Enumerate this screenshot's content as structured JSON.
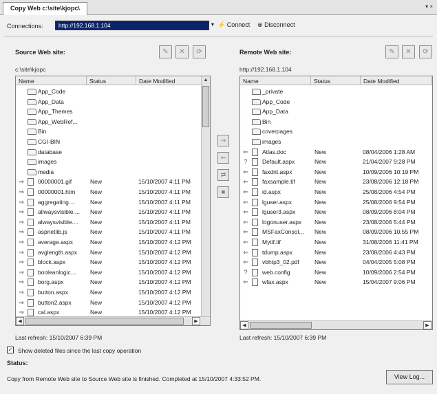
{
  "tab": {
    "title": "Copy Web c:\\site\\kjopc\\",
    "menu_glyph": "▾ ×"
  },
  "connection": {
    "label": "Connections:",
    "url": "http://192.168.1.104",
    "connect_label": "Connect",
    "disconnect_label": "Disconnect"
  },
  "source": {
    "title": "Source Web site:",
    "path": "c:\\site\\kjopc",
    "columns": {
      "name": "Name",
      "status": "Status",
      "date": "Date Modified"
    },
    "rows": [
      {
        "arrow": "",
        "icon": "folder",
        "name": "App_Code",
        "status": "",
        "date": ""
      },
      {
        "arrow": "",
        "icon": "folder",
        "name": "App_Data",
        "status": "",
        "date": ""
      },
      {
        "arrow": "",
        "icon": "folder",
        "name": "App_Themes",
        "status": "",
        "date": ""
      },
      {
        "arrow": "",
        "icon": "folder",
        "name": "App_WebRef...",
        "status": "",
        "date": ""
      },
      {
        "arrow": "",
        "icon": "folder",
        "name": "Bin",
        "status": "",
        "date": ""
      },
      {
        "arrow": "",
        "icon": "folder",
        "name": "CGI-BIN",
        "status": "",
        "date": ""
      },
      {
        "arrow": "",
        "icon": "folder",
        "name": "database",
        "status": "",
        "date": ""
      },
      {
        "arrow": "",
        "icon": "folder",
        "name": "images",
        "status": "",
        "date": ""
      },
      {
        "arrow": "",
        "icon": "folder",
        "name": "media",
        "status": "",
        "date": ""
      },
      {
        "arrow": "⇒",
        "icon": "file",
        "name": "00000001.gif",
        "status": "New",
        "date": "15/10/2007 4:11 PM"
      },
      {
        "arrow": "⇒",
        "icon": "file",
        "name": "00000001.htm",
        "status": "New",
        "date": "15/10/2007 4:11 PM"
      },
      {
        "arrow": "⇒",
        "icon": "file",
        "name": "aggregating....",
        "status": "New",
        "date": "15/10/2007 4:11 PM"
      },
      {
        "arrow": "⇒",
        "icon": "file",
        "name": "allwaysvisible....",
        "status": "New",
        "date": "15/10/2007 4:11 PM"
      },
      {
        "arrow": "⇒",
        "icon": "file",
        "name": "alwaysvisible....",
        "status": "New",
        "date": "15/10/2007 4:11 PM"
      },
      {
        "arrow": "⇒",
        "icon": "file",
        "name": "aspnetlib.js",
        "status": "New",
        "date": "15/10/2007 4:11 PM"
      },
      {
        "arrow": "⇒",
        "icon": "file",
        "name": "average.aspx",
        "status": "New",
        "date": "15/10/2007 4:12 PM"
      },
      {
        "arrow": "⇒",
        "icon": "file",
        "name": "avglength.aspx",
        "status": "New",
        "date": "15/10/2007 4:12 PM"
      },
      {
        "arrow": "⇒",
        "icon": "file",
        "name": "block.aspx",
        "status": "New",
        "date": "15/10/2007 4:12 PM"
      },
      {
        "arrow": "⇒",
        "icon": "file",
        "name": "booleanlogic....",
        "status": "New",
        "date": "15/10/2007 4:12 PM"
      },
      {
        "arrow": "⇒",
        "icon": "file",
        "name": "borg.aspx",
        "status": "New",
        "date": "15/10/2007 4:12 PM"
      },
      {
        "arrow": "⇒",
        "icon": "file",
        "name": "button.aspx",
        "status": "New",
        "date": "15/10/2007 4:12 PM"
      },
      {
        "arrow": "⇒",
        "icon": "file",
        "name": "button2.aspx",
        "status": "New",
        "date": "15/10/2007 4:12 PM"
      },
      {
        "arrow": "⇒",
        "icon": "file",
        "name": "cal.aspx",
        "status": "New",
        "date": "15/10/2007 4:12 PM"
      }
    ],
    "last_refresh": "Last refresh: 15/10/2007 6:39 PM"
  },
  "remote": {
    "title": "Remote Web site:",
    "path": "http://192.168.1.104",
    "columns": {
      "name": "Name",
      "status": "Status",
      "date": "Date Modified"
    },
    "rows": [
      {
        "arrow": "",
        "icon": "folder",
        "name": "_private",
        "status": "",
        "date": ""
      },
      {
        "arrow": "",
        "icon": "folder",
        "name": "App_Code",
        "status": "",
        "date": ""
      },
      {
        "arrow": "",
        "icon": "folder",
        "name": "App_Data",
        "status": "",
        "date": ""
      },
      {
        "arrow": "",
        "icon": "folder",
        "name": "Bin",
        "status": "",
        "date": ""
      },
      {
        "arrow": "",
        "icon": "folder",
        "name": "coverpages",
        "status": "",
        "date": ""
      },
      {
        "arrow": "",
        "icon": "folder",
        "name": "images",
        "status": "",
        "date": ""
      },
      {
        "arrow": "⇐",
        "icon": "file",
        "name": "Atlas.doc",
        "status": "New",
        "date": "08/04/2006 1:28 AM"
      },
      {
        "arrow": "?",
        "icon": "file",
        "name": "Default.aspx",
        "status": "New",
        "date": "21/04/2007 9:28 PM"
      },
      {
        "arrow": "⇐",
        "icon": "file",
        "name": "faxdnt.aspx",
        "status": "New",
        "date": "10/09/2006 10:19 PM"
      },
      {
        "arrow": "⇐",
        "icon": "file",
        "name": "faxsample.tif",
        "status": "New",
        "date": "23/08/2006 12:18 PM"
      },
      {
        "arrow": "⇐",
        "icon": "file",
        "name": "id.aspx",
        "status": "New",
        "date": "25/08/2006 4:54 PM"
      },
      {
        "arrow": "⇐",
        "icon": "file",
        "name": "lguser.aspx",
        "status": "New",
        "date": "25/08/2006 9:54 PM"
      },
      {
        "arrow": "⇐",
        "icon": "file",
        "name": "lguser3.aspx",
        "status": "New",
        "date": "08/09/2006 8:04 PM"
      },
      {
        "arrow": "⇐",
        "icon": "file",
        "name": "logonuser.aspx",
        "status": "New",
        "date": "23/08/2006 5:44 PM"
      },
      {
        "arrow": "⇐",
        "icon": "file",
        "name": "MSFaxConsol...",
        "status": "New",
        "date": "08/09/2006 10:55 PM"
      },
      {
        "arrow": "⇐",
        "icon": "file",
        "name": "Mytif.tif",
        "status": "New",
        "date": "31/08/2006 11:41 PM"
      },
      {
        "arrow": "⇐",
        "icon": "file",
        "name": "tdump.aspx",
        "status": "New",
        "date": "23/08/2006 4:43 PM"
      },
      {
        "arrow": "⇐",
        "icon": "file",
        "name": "vbhtp3_02.pdf",
        "status": "New",
        "date": "04/04/2005 5:08 PM"
      },
      {
        "arrow": "?",
        "icon": "file",
        "name": "web.config",
        "status": "New",
        "date": "10/09/2006 2:54 PM"
      },
      {
        "arrow": "⇐",
        "icon": "file",
        "name": "wfax.aspx",
        "status": "New",
        "date": "15/04/2007 9:06 PM"
      }
    ],
    "last_refresh": "Last refresh: 15/10/2007 6:39 PM"
  },
  "options": {
    "show_deleted_label": "Show deleted files since the last copy operation",
    "show_deleted_checked": "✓"
  },
  "status": {
    "label": "Status:",
    "message": "Copy from Remote Web site to Source Web site is finished. Completed at 15/10/2007 4:33:52 PM."
  },
  "view_log_label": "View Log..."
}
